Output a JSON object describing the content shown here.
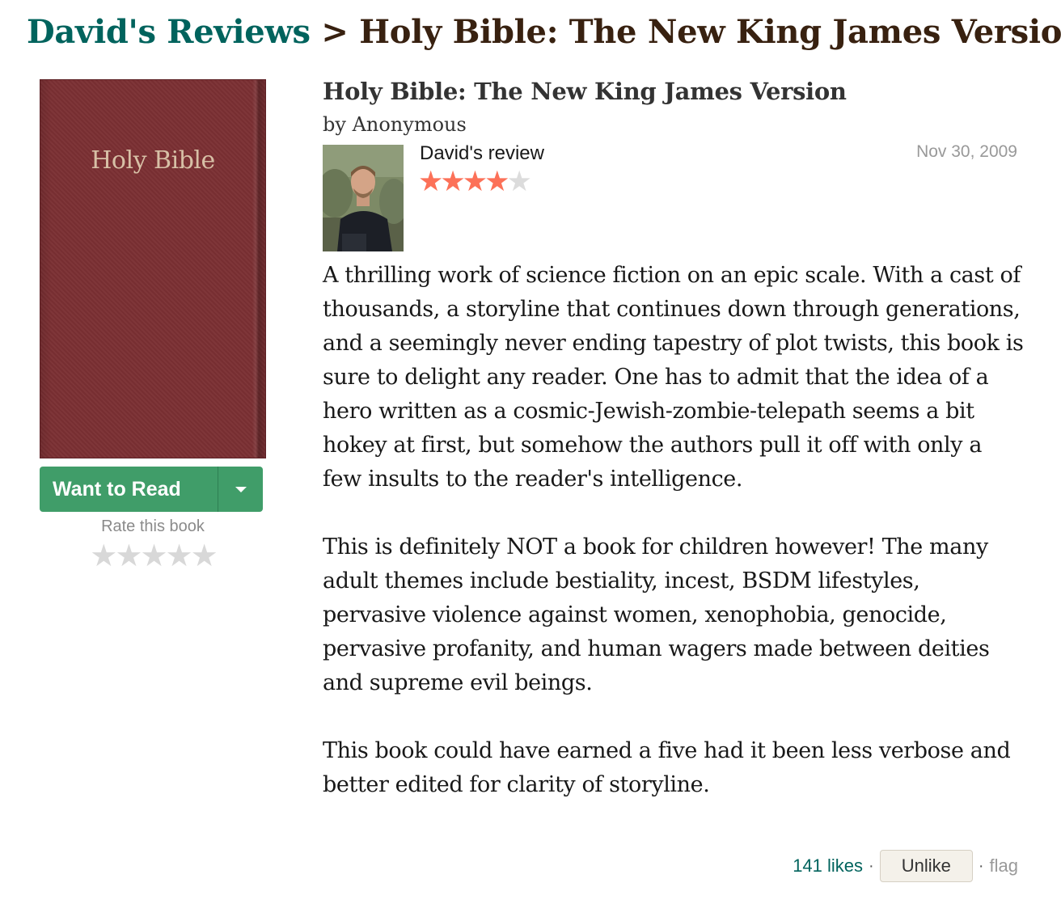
{
  "breadcrumb": {
    "parent": "David's Reviews",
    "separator": ">",
    "current": "Holy Bible: The New King James Version"
  },
  "book": {
    "cover_text": "Holy Bible",
    "title": "Holy Bible: The New King James Version",
    "by_prefix": "by",
    "author": "Anonymous"
  },
  "shelf": {
    "want_to_read_label": "Want to Read",
    "rate_label": "Rate this book",
    "rate_stars": [
      "★",
      "★",
      "★",
      "★",
      "★"
    ]
  },
  "review": {
    "reviewer_name": "David",
    "reviewer_suffix": "'s review",
    "rating": 4,
    "max_rating": 5,
    "stars_filled": "★★★★",
    "stars_empty": "★",
    "date": "Nov 30, 2009",
    "paragraphs": [
      "A thrilling work of science fiction on an epic scale. With a cast of thousands, a storyline that continues down through generations, and a seemingly never ending tapestry of plot twists, this book is sure to delight any reader. One has to admit that the idea of a hero written as a cosmic-Jewish-zombie-telepath seems a bit hokey at first, but somehow the authors pull it off with only a few insults to the reader's intelligence.",
      "This is definitely NOT a book for children however! The many adult themes include bestiality, incest, BSDM lifestyles, pervasive violence against women, xenophobia, genocide, pervasive profanity, and human wagers made between deities and supreme evil beings.",
      "This book could have earned a five had it been less verbose and better edited for clarity of storyline."
    ]
  },
  "footer": {
    "likes_label": "141 likes",
    "separator": "·",
    "unlike_label": "Unlike",
    "flag_label": "flag"
  },
  "colors": {
    "link_green": "#00635d",
    "breadcrumb_brown": "#382110",
    "button_green": "#409d69",
    "star_orange": "#fc7158",
    "cover_maroon": "#7b2f33"
  }
}
